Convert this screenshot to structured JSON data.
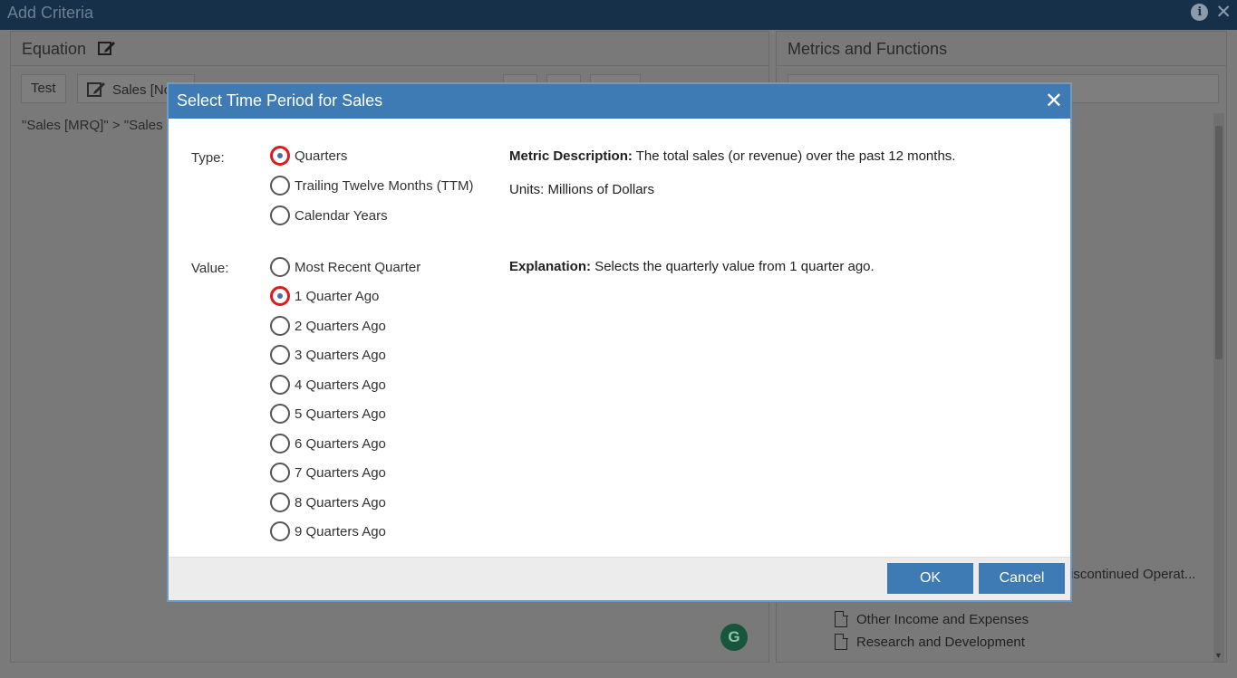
{
  "window": {
    "title": "Add Criteria",
    "info_glyph": "i",
    "close_glyph": "✕"
  },
  "equation_panel": {
    "title": "Equation",
    "test_label": "Test",
    "sales_label": "Sales [No",
    "expression": "\"Sales [MRQ]\"  >  \"Sales"
  },
  "metrics_panel": {
    "title": "Metrics and Functions",
    "partial_item": "iscontinued Operat...",
    "tree_items": [
      "Other Income and Expenses",
      "Research and Development"
    ]
  },
  "grammarly_badge": "G",
  "modal": {
    "title": "Select Time Period for Sales",
    "close_glyph": "✕",
    "type_label": "Type:",
    "type_options": [
      {
        "label": "Quarters",
        "checked": true
      },
      {
        "label": "Trailing Twelve Months (TTM)",
        "checked": false
      },
      {
        "label": "Calendar Years",
        "checked": false
      }
    ],
    "value_label": "Value:",
    "value_options": [
      {
        "label": "Most Recent Quarter",
        "checked": false
      },
      {
        "label": "1 Quarter Ago",
        "checked": true
      },
      {
        "label": "2 Quarters Ago",
        "checked": false
      },
      {
        "label": "3 Quarters Ago",
        "checked": false
      },
      {
        "label": "4 Quarters Ago",
        "checked": false
      },
      {
        "label": "5 Quarters Ago",
        "checked": false
      },
      {
        "label": "6 Quarters Ago",
        "checked": false
      },
      {
        "label": "7 Quarters Ago",
        "checked": false
      },
      {
        "label": "8 Quarters Ago",
        "checked": false
      },
      {
        "label": "9 Quarters Ago",
        "checked": false
      }
    ],
    "metric_description_label": "Metric Description:",
    "metric_description": "The total sales (or revenue) over the past 12 months.",
    "units": "Units: Millions of Dollars",
    "explanation_label": "Explanation:",
    "explanation": "Selects the quarterly value from 1 quarter ago.",
    "ok_label": "OK",
    "cancel_label": "Cancel"
  },
  "colors": {
    "modal_header": "#3e7ab3",
    "primary_button": "#3e7ab3",
    "highlight_ring": "#e01a1a",
    "titlebar": "#17304a"
  }
}
